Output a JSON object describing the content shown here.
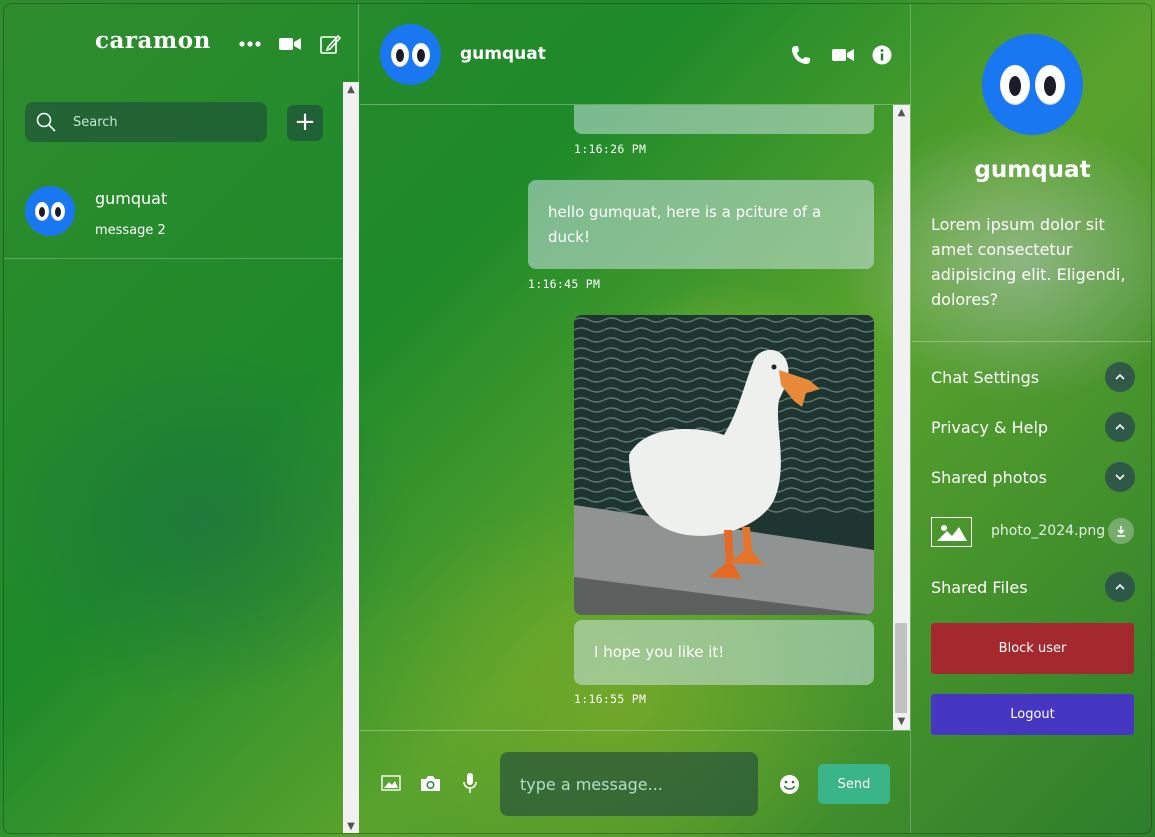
{
  "sidebar": {
    "username": "caramon",
    "icons": {
      "more": "more-dots-icon",
      "video": "video-icon",
      "compose": "compose-icon"
    },
    "search_placeholder": "Search",
    "add_label": "+",
    "contacts": [
      {
        "name": "gumquat",
        "last_message": "message 2"
      }
    ]
  },
  "chat": {
    "contact_name": "gumquat",
    "header_icons": [
      "phone-icon",
      "video-icon",
      "info-icon"
    ],
    "messages": [
      {
        "text": "",
        "time": "1:16:26 PM"
      },
      {
        "text": "hello gumquat, here is a pciture of a duck!",
        "time": "1:16:45 PM"
      },
      {
        "image": "duck-photo",
        "text": "I hope you like it!",
        "time": "1:16:55 PM"
      }
    ],
    "composer": {
      "placeholder": "type a message...",
      "send_label": "Send",
      "tool_icons": [
        "image-icon",
        "camera-icon",
        "microphone-icon",
        "emoji-icon"
      ]
    }
  },
  "details": {
    "name": "gumquat",
    "bio": "Lorem ipsum dolor sit amet consectetur adipisicing elit. Eligendi, dolores?",
    "options": [
      {
        "label": "Chat Settings",
        "state": "collapsed-up"
      },
      {
        "label": "Privacy & Help",
        "state": "collapsed-up"
      },
      {
        "label": "Shared photos",
        "state": "expanded-down"
      },
      {
        "label": "Shared Files",
        "state": "collapsed-up"
      }
    ],
    "shared_photo": {
      "filename": "photo_2024.png"
    },
    "block_label": "Block user",
    "logout_label": "Logout",
    "colors": {
      "block": "#a3292e",
      "logout": "#4637c2",
      "send": "#3ab58a",
      "avatar": "#1977f2"
    }
  }
}
